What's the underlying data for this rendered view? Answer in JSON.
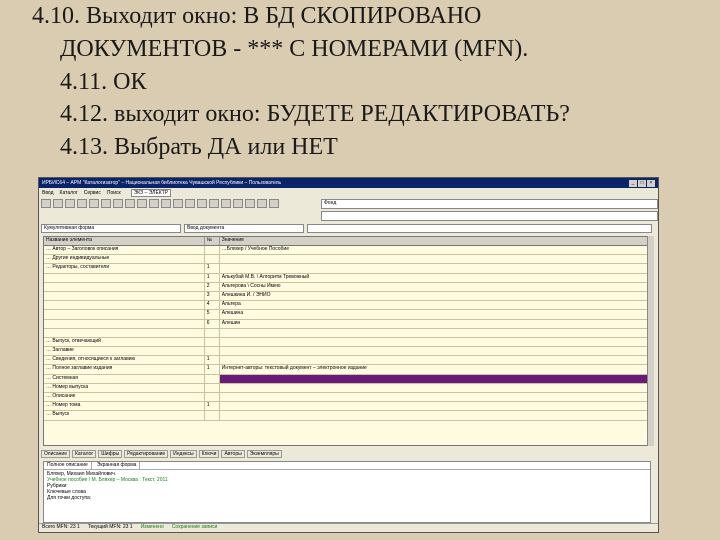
{
  "slide": {
    "line1": "4.10. Выходит окно: В БД СКОПИРОВАНО",
    "line2": "ДОКУМЕНТОВ - *** С НОМЕРАМИ (MFN).",
    "line3": "4.11. ОК",
    "line4": "4.12. выходит окно: БУДЕТЕ РЕДАКТИРОВАТЬ?",
    "line5": "4.13. Выбрать ДА или НЕТ"
  },
  "app": {
    "title": "ИРБИС64 – АРМ \"Каталогизатор\" – Национальная библиотека Чувашской Республики – Пользователь",
    "menu": [
      "Ввод",
      "Каталог",
      "Сервис",
      "Поиск"
    ],
    "db": "ЭКЗ – ЭЛЕКТР",
    "panel_rows": [
      "Фонд",
      ""
    ],
    "filters": [
      "Кумулятивная форма",
      "Ввод документа",
      ""
    ],
    "grid": {
      "headers": [
        "Название элемента",
        "№",
        "Значение"
      ],
      "rows": [
        {
          "name": "… Автор – Заголовок описания",
          "num": "",
          "value": "…Бляхер / Учебное Пособие"
        },
        {
          "name": "… Другие индивидуальные",
          "num": "",
          "value": ""
        },
        {
          "name": "… Редакторы, составители",
          "num": "1",
          "value": ""
        },
        {
          "name": "",
          "num": "1",
          "value": "Алькубай М.В. \\ Алгоритм Тревожный"
        },
        {
          "name": "",
          "num": "2",
          "value": "Альтерова \\ Сосны Имею"
        },
        {
          "name": "",
          "num": "3",
          "value": "Алешкина И. / ЭНИО"
        },
        {
          "name": "",
          "num": "4",
          "value": "Альтера"
        },
        {
          "name": "",
          "num": "5",
          "value": "Алешина"
        },
        {
          "name": "",
          "num": "6",
          "value": "Алешин"
        },
        {
          "name": "",
          "num": "",
          "value": ""
        },
        {
          "name": "… Выпуск, отвечающий",
          "num": "",
          "value": ""
        },
        {
          "name": "… Заглавие",
          "num": "",
          "value": ""
        },
        {
          "name": "… Сведения, относящиеся к заглавию",
          "num": "1",
          "value": ""
        },
        {
          "name": "… Полное заглавие издания",
          "num": "1",
          "value": "Интернет-авторы: текстовый документ – электронное издание"
        },
        {
          "name": "… Системная",
          "num": "",
          "value": ""
        },
        {
          "name": "… Номер выпуска",
          "num": "",
          "value": ""
        },
        {
          "name": "… Описание",
          "num": "",
          "value": ""
        },
        {
          "name": "… Номер тома",
          "num": "1",
          "value": ""
        },
        {
          "name": "… Выпуск",
          "num": "",
          "value": ""
        }
      ]
    },
    "tabs": [
      "Описание",
      "Каталог",
      "Шифры",
      "Редактирование",
      "Индексы",
      "Ключи",
      "Авторы",
      "Экземпляры"
    ],
    "preview_tabs": [
      "Полное описание",
      "Экранная форма"
    ],
    "preview_lines": [
      "Бляхер, Михаил Михайлович.",
      "Учебное пособие / М. Бляхер – Москва : Текст, 2011",
      "Рубрики:",
      "Ключевые слова",
      "Для точки доступа:"
    ],
    "status": [
      "Всего MFN: 23 1",
      "Текущий MFN: 23 1",
      "Изменено",
      "Сохранение записи"
    ]
  },
  "colors": {
    "background": "#d9ccb0",
    "title": "#0a246a",
    "grid": "#fffbe0",
    "highlight": "#6a1a7a"
  }
}
